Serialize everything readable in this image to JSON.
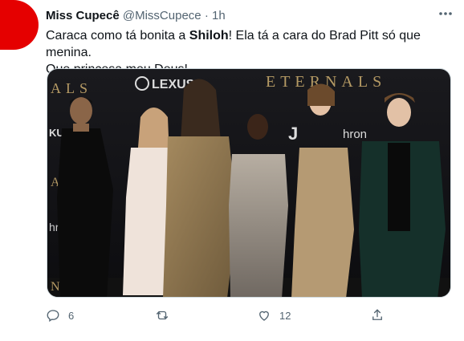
{
  "tweet": {
    "author_name": "Miss Cupecê",
    "author_handle": "@MissCupece",
    "separator": "·",
    "time": "1h",
    "text_line1_prefix": "Caraca como tá bonita a ",
    "text_bold_name": "Shiloh",
    "text_line1_suffix": "! Ela tá a cara do Brad Pitt só que menina.",
    "text_line2": "Que princesa meu Deus!",
    "avatar_color": "#e50000",
    "more_icon": "more-horizontal-icon"
  },
  "media": {
    "backdrop_texts": {
      "left": "ALS",
      "lexus_logo": "LEXUS",
      "eternals": "ETERNALS",
      "kus": "KUS",
      "a_left": "A",
      "hr": "hro",
      "n_bottom": "NAL",
      "j_logo": "J",
      "hron": "hron"
    }
  },
  "actions": {
    "reply_icon": "reply-icon",
    "reply_count": "6",
    "retweet_icon": "retweet-icon",
    "like_icon": "heart-icon",
    "like_count": "12",
    "share_icon": "share-icon"
  }
}
